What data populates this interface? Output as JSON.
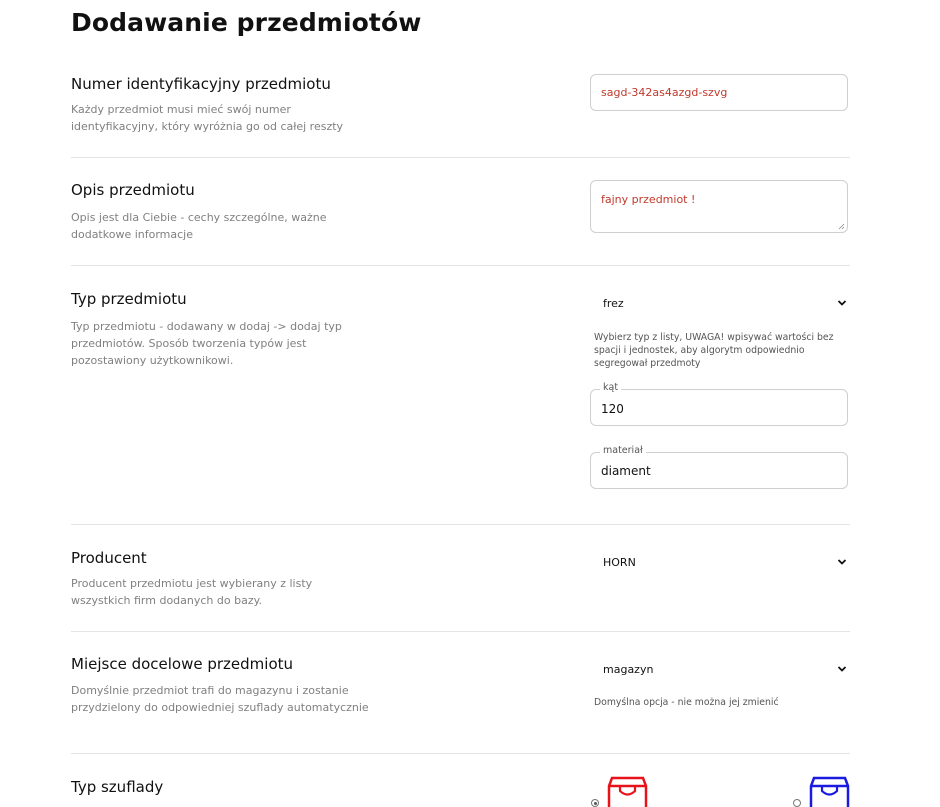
{
  "page_title": "Dodawanie przedmiotów",
  "sections": {
    "id": {
      "title": "Numer identyfikacyjny przedmiotu",
      "desc": "Każdy przedmiot musi mieć swój numer identyfikacyjny, który wyróżnia go od całej reszty",
      "value": "sagd-342as4azgd-szvg"
    },
    "desc": {
      "title": "Opis przedmiotu",
      "desc": "Opis jest dla Ciebie - cechy szczególne, ważne dodatkowe informacje",
      "value": "fajny przedmiot !"
    },
    "type": {
      "title": "Typ przedmiotu",
      "desc": "Typ przedmiotu - dodawany w dodaj -> dodaj typ przedmiotów. Sposób tworzenia typów jest pozostawiony użytkownikowi.",
      "selected": "frez",
      "hint": "Wybierz typ z listy, UWAGA! wpisywać wartości bez spacji i jednostek, aby algorytm odpowiednio segregował przedmoty",
      "fields": [
        {
          "label": "kąt",
          "value": "120"
        },
        {
          "label": "materiał",
          "value": "diament"
        }
      ]
    },
    "producer": {
      "title": "Producent",
      "desc": "Producent przedmiotu jest wybierany z listy wszystkich firm dodanych do bazy.",
      "selected": "HORN"
    },
    "location": {
      "title": "Miejsce docelowe przedmiotu",
      "desc": "Domyślnie przedmiot trafi do magazynu i zostanie przydzielony do odpowiedniej szuflady automatycznie",
      "selected": "magazyn",
      "hint": "Domyślna opcja - nie można jej zmienić"
    },
    "drawer": {
      "title": "Typ szuflady",
      "options": [
        {
          "color": "#e8121b",
          "checked": true
        },
        {
          "color": "#1a1ae0",
          "checked": false
        }
      ]
    }
  },
  "colors": {
    "value_red": "#c0392b",
    "divider": "#e4e4e4",
    "description_gray": "#808080"
  }
}
